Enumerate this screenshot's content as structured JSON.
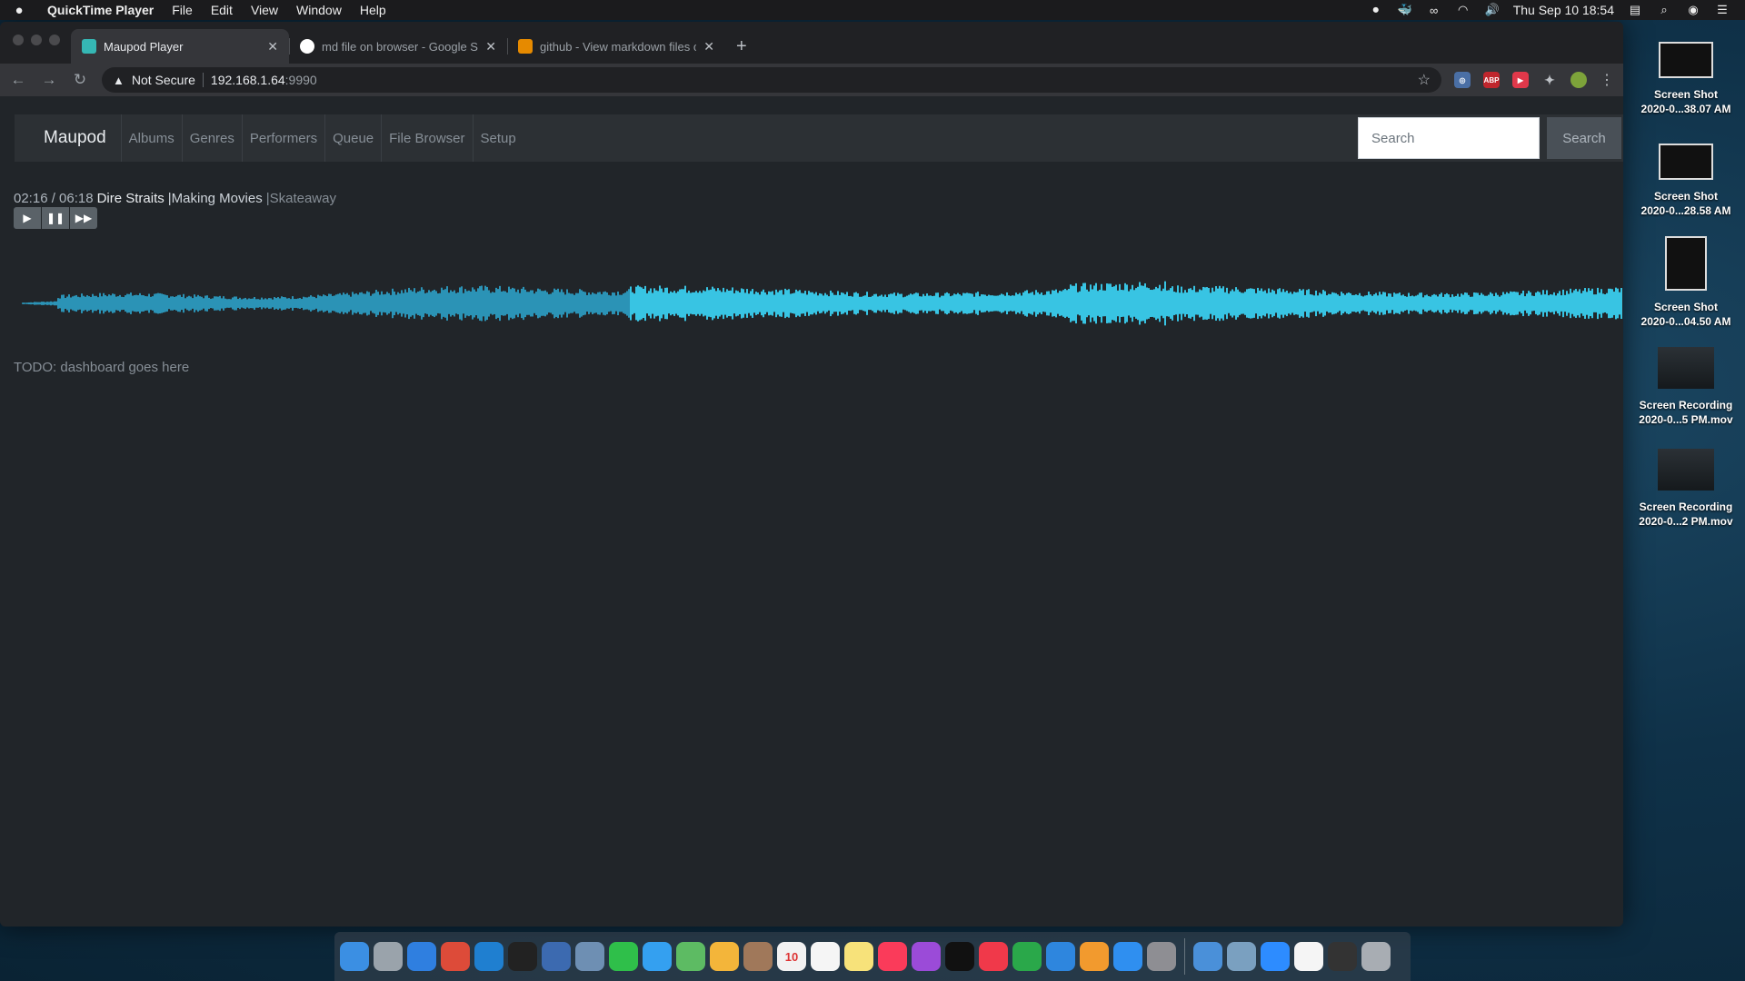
{
  "menubar": {
    "app_name": "QuickTime Player",
    "items": [
      "File",
      "Edit",
      "View",
      "Window",
      "Help"
    ],
    "clock": "Thu Sep 10  18:54"
  },
  "browser": {
    "tabs": [
      {
        "title": "Maupod Player",
        "favicon_color": "#35b7b4",
        "active": true
      },
      {
        "title": "md file on browser - Google Se",
        "favicon_color": "#ffffff",
        "active": false
      },
      {
        "title": "github - View markdown files o",
        "favicon_color": "#e68a00",
        "active": false
      }
    ],
    "omnibox": {
      "security": "Not Secure",
      "host": "192.168.1.64",
      "port": ":9990"
    }
  },
  "app": {
    "brand": "Maupod",
    "nav": [
      "Albums",
      "Genres",
      "Performers",
      "Queue",
      "File Browser",
      "Setup"
    ],
    "search": {
      "placeholder": "Search",
      "button": "Search"
    },
    "now_playing": {
      "time": "02:16 / 06:18",
      "artist": "Dire Straits",
      "album": "|Making Movies",
      "track": "|Skateaway"
    },
    "waveform": {
      "progress": 0.38,
      "played_color": "#2b93b6",
      "unplayed_color": "#38c4e3"
    },
    "todo": "TODO: dashboard goes here"
  },
  "desktop": {
    "icons": [
      {
        "line1": "Screen Shot",
        "line2": "2020-0...38.07 AM"
      },
      {
        "line1": "Screen Shot",
        "line2": "2020-0...28.58 AM"
      },
      {
        "line1": "Screen Shot",
        "line2": "2020-0...04.50 AM"
      },
      {
        "line1": "Screen Recording",
        "line2": "2020-0...5 PM.mov"
      },
      {
        "line1": "Screen Recording",
        "line2": "2020-0...2 PM.mov"
      }
    ]
  },
  "dock": {
    "calendar_day": "10",
    "items": [
      {
        "name": "finder",
        "color": "#3b8fe3"
      },
      {
        "name": "launchpad",
        "color": "#9aa3ab"
      },
      {
        "name": "safari",
        "color": "#2f7fe0"
      },
      {
        "name": "chrome",
        "color": "#dd4b39"
      },
      {
        "name": "vscode",
        "color": "#1f7fd0"
      },
      {
        "name": "terminal",
        "color": "#222222"
      },
      {
        "name": "virtualbox",
        "color": "#3c6ab0"
      },
      {
        "name": "preview",
        "color": "#6e8fb3"
      },
      {
        "name": "facetime",
        "color": "#2fbf4a"
      },
      {
        "name": "messages",
        "color": "#34a0f0"
      },
      {
        "name": "maps",
        "color": "#5dbb63"
      },
      {
        "name": "photos",
        "color": "#f3b53a"
      },
      {
        "name": "contacts",
        "color": "#a0785a"
      },
      {
        "name": "calendar",
        "color": "#f2f2f2"
      },
      {
        "name": "reminders",
        "color": "#f5f5f5"
      },
      {
        "name": "notes",
        "color": "#f7e27a"
      },
      {
        "name": "music",
        "color": "#fa3b5a"
      },
      {
        "name": "podcasts",
        "color": "#9b4bd8"
      },
      {
        "name": "tv",
        "color": "#111111"
      },
      {
        "name": "news",
        "color": "#f0394a"
      },
      {
        "name": "numbers",
        "color": "#2aa84a"
      },
      {
        "name": "keynote",
        "color": "#2e86de"
      },
      {
        "name": "pages",
        "color": "#f29a2e"
      },
      {
        "name": "app-store",
        "color": "#2f8ff0"
      },
      {
        "name": "system-preferences",
        "color": "#8e8e93"
      }
    ],
    "trailing": [
      {
        "name": "downloads",
        "color": "#4a90d9"
      },
      {
        "name": "screenshots",
        "color": "#7aa0c0"
      },
      {
        "name": "zoom",
        "color": "#2d8cff"
      },
      {
        "name": "document",
        "color": "#f5f5f5"
      },
      {
        "name": "terminal-window",
        "color": "#333333"
      },
      {
        "name": "trash",
        "color": "#a8adb3"
      }
    ]
  }
}
